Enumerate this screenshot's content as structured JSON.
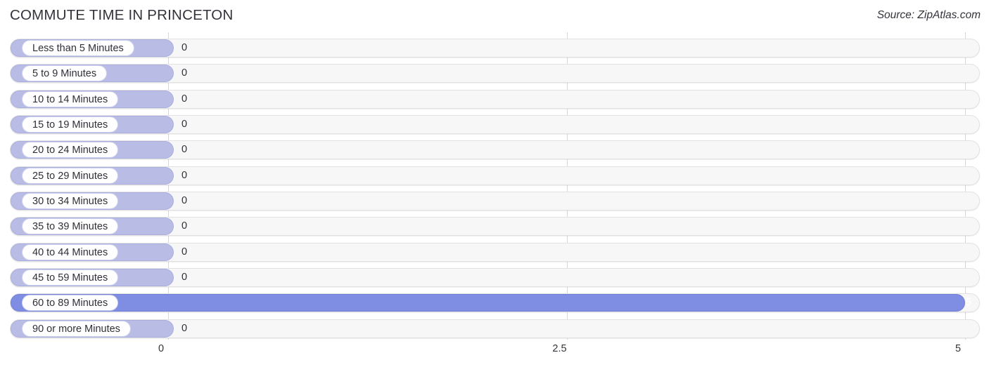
{
  "header": {
    "title": "COMMUTE TIME IN PRINCETON",
    "source": "Source: ZipAtlas.com"
  },
  "chart_data": {
    "type": "bar",
    "orientation": "horizontal",
    "title": "COMMUTE TIME IN PRINCETON",
    "xlabel": "",
    "ylabel": "",
    "xlim": [
      0,
      5
    ],
    "grid": true,
    "legend": false,
    "xticks": [
      "0",
      "2.5",
      "5"
    ],
    "xtick_values": [
      0,
      2.5,
      5
    ],
    "categories": [
      "Less than 5 Minutes",
      "5 to 9 Minutes",
      "10 to 14 Minutes",
      "15 to 19 Minutes",
      "20 to 24 Minutes",
      "25 to 29 Minutes",
      "30 to 34 Minutes",
      "35 to 39 Minutes",
      "40 to 44 Minutes",
      "45 to 59 Minutes",
      "60 to 89 Minutes",
      "90 or more Minutes"
    ],
    "values": [
      0,
      0,
      0,
      0,
      0,
      0,
      0,
      0,
      0,
      0,
      5,
      0
    ],
    "value_labels": [
      "0",
      "0",
      "0",
      "0",
      "0",
      "0",
      "0",
      "0",
      "0",
      "0",
      "5",
      "0"
    ],
    "highlight_index": 10,
    "colors": {
      "bar": "#b9bde6",
      "bar_border": "#a9aedd",
      "bar_highlight": "#7f8de2",
      "bar_highlight_border": "#6f7ed8",
      "track": "#f7f7f8",
      "track_border": "#e2e2e4",
      "gridline": "#d8d8d8",
      "text": "#2f2f38",
      "value_inside_text": "#ffffff"
    }
  },
  "rows": [
    {
      "label": "Less than 5 Minutes",
      "value": "0",
      "highlight": false
    },
    {
      "label": "5 to 9 Minutes",
      "value": "0",
      "highlight": false
    },
    {
      "label": "10 to 14 Minutes",
      "value": "0",
      "highlight": false
    },
    {
      "label": "15 to 19 Minutes",
      "value": "0",
      "highlight": false
    },
    {
      "label": "20 to 24 Minutes",
      "value": "0",
      "highlight": false
    },
    {
      "label": "25 to 29 Minutes",
      "value": "0",
      "highlight": false
    },
    {
      "label": "30 to 34 Minutes",
      "value": "0",
      "highlight": false
    },
    {
      "label": "35 to 39 Minutes",
      "value": "0",
      "highlight": false
    },
    {
      "label": "40 to 44 Minutes",
      "value": "0",
      "highlight": false
    },
    {
      "label": "45 to 59 Minutes",
      "value": "0",
      "highlight": false
    },
    {
      "label": "60 to 89 Minutes",
      "value": "5",
      "highlight": true
    },
    {
      "label": "90 or more Minutes",
      "value": "0",
      "highlight": false
    }
  ],
  "axis": {
    "ticks": [
      {
        "label": "0",
        "value": 0
      },
      {
        "label": "2.5",
        "value": 2.5
      },
      {
        "label": "5",
        "value": 5
      }
    ]
  }
}
